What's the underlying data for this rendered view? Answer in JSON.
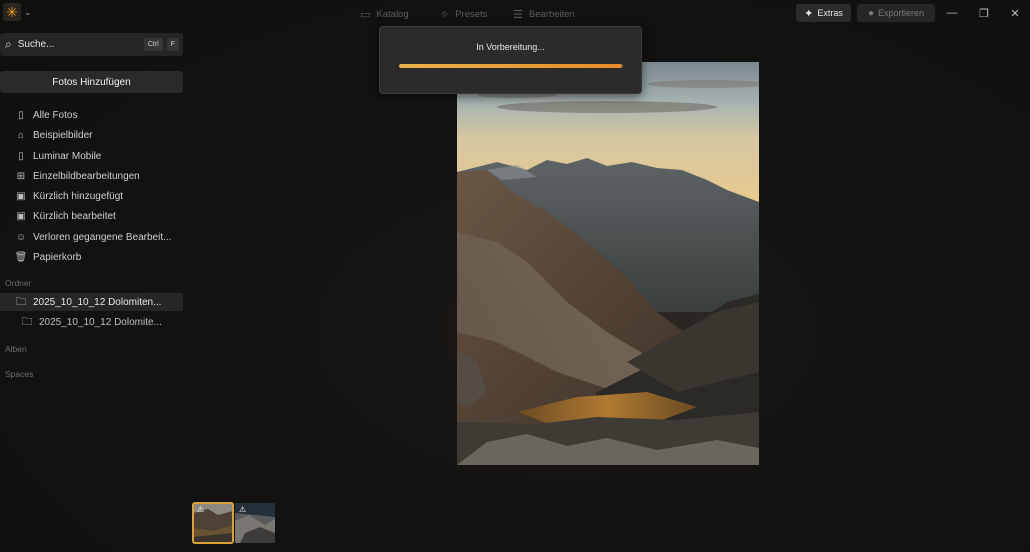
{
  "titlebar": {
    "tabs": [
      {
        "label": "Katalog",
        "icon": "folder-icon"
      },
      {
        "label": "Presets",
        "icon": "sparkle-icon"
      },
      {
        "label": "Bearbeiten",
        "icon": "sliders-icon"
      }
    ],
    "extras_label": "Extras",
    "export_label": "Exportieren"
  },
  "sidebar": {
    "search": {
      "placeholder": "Suche...",
      "shortcut_1": "Ctrl",
      "shortcut_2": "F"
    },
    "add_photos_label": "Fotos Hinzufügen",
    "items": [
      {
        "label": "Alle Fotos",
        "icon": "clipboard-icon"
      },
      {
        "label": "Beispielbilder",
        "icon": "graduation-cap-icon"
      },
      {
        "label": "Luminar Mobile",
        "icon": "phone-icon"
      },
      {
        "label": "Einzelbildbearbeitungen",
        "icon": "grid-icon"
      },
      {
        "label": "Kürzlich hinzugefügt",
        "icon": "image-clock-icon"
      },
      {
        "label": "Kürzlich bearbeitet",
        "icon": "image-edit-icon"
      },
      {
        "label": "Verloren gegangene Bearbeit...",
        "icon": "lost-edits-icon"
      },
      {
        "label": "Papierkorb",
        "icon": "trash-icon"
      }
    ],
    "sections": {
      "folders": "Ordner",
      "albums": "Alben",
      "spaces": "Spaces"
    },
    "folders": [
      {
        "label": "2025_10_10_12 Dolomiten...",
        "active": true
      },
      {
        "label": "2025_10_10_12 Dolomite...",
        "active": false
      }
    ]
  },
  "dialog": {
    "label": "In Vorbereitung...",
    "progress": 0.99
  },
  "colors": {
    "accent": "#e88a2a",
    "selection": "#d9a23a"
  }
}
